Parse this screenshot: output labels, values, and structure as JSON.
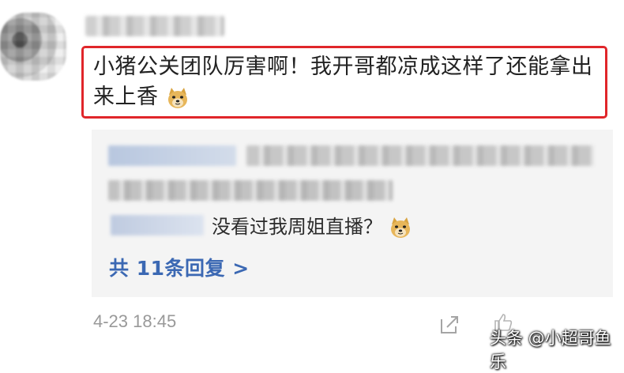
{
  "comment": {
    "text": "小猪公关团队厉害啊！我开哥都凉成这样了还能拿出来上香",
    "emoji": "doge-emoji"
  },
  "reply": {
    "text": "没看过我周姐直播？",
    "emoji": "doge-emoji"
  },
  "view_replies": "共 11条回复 >",
  "timestamp": "4-23 18:45",
  "watermark": "头条 @小超哥鱼乐",
  "icons": {
    "share": "share-icon",
    "like": "like-icon"
  },
  "colors": {
    "highlight_border": "#e0262a",
    "link": "#3b68b3",
    "reply_bg": "#f4f4f4"
  }
}
